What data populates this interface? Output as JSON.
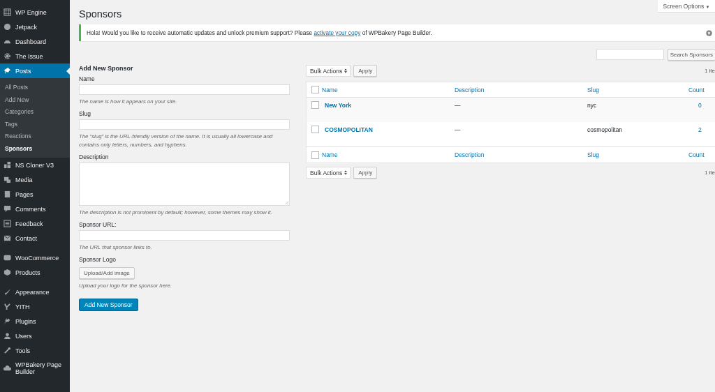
{
  "sidebar": {
    "sections": [
      {
        "items": [
          {
            "label": "WP Engine",
            "selected": false
          },
          {
            "label": "Jetpack",
            "selected": false
          },
          {
            "label": "Dashboard",
            "selected": false
          },
          {
            "label": "The Issue",
            "selected": false
          },
          {
            "label": "Posts",
            "selected": true,
            "children": [
              {
                "label": "All Posts",
                "selected": false
              },
              {
                "label": "Add New",
                "selected": false
              },
              {
                "label": "Categories",
                "selected": false
              },
              {
                "label": "Tags",
                "selected": false
              },
              {
                "label": "Reactions",
                "selected": false
              },
              {
                "label": "Sponsors",
                "selected": true
              }
            ]
          },
          {
            "label": "NS Cloner V3",
            "selected": false
          },
          {
            "label": "Media",
            "selected": false
          },
          {
            "label": "Pages",
            "selected": false
          },
          {
            "label": "Comments",
            "selected": false
          },
          {
            "label": "Feedback",
            "selected": false
          },
          {
            "label": "Contact",
            "selected": false
          }
        ]
      },
      {
        "items": [
          {
            "label": "WooCommerce",
            "selected": false
          },
          {
            "label": "Products",
            "selected": false
          }
        ]
      },
      {
        "items": [
          {
            "label": "Appearance",
            "selected": false
          },
          {
            "label": "YITH",
            "selected": false
          },
          {
            "label": "Plugins",
            "selected": false
          },
          {
            "label": "Users",
            "selected": false
          },
          {
            "label": "Tools",
            "selected": false
          },
          {
            "label": "WPBakery Page Builder",
            "selected": false
          }
        ]
      }
    ]
  },
  "screen_options": {
    "label": "Screen Options",
    "caret": "▼"
  },
  "page_title": "Sponsors",
  "notice": {
    "before": "Hola! Would you like to receive automatic updates and unlock premium support? Please",
    "link": "activate your copy",
    "after": "of WPBakery Page Builder."
  },
  "form": {
    "heading": "Add New Sponsor",
    "fields": [
      {
        "kind": "input",
        "label": "Name",
        "hint": "The name is how it appears on your site."
      },
      {
        "kind": "input",
        "label": "Slug",
        "hint": "The “slug” is the URL-friendly version of the name. It is usually all lowercase and contains only letters, numbers, and hyphens."
      },
      {
        "kind": "textarea",
        "label": "Description",
        "hint": "The description is not prominent by default; however, some themes may show it."
      },
      {
        "kind": "input",
        "label": "Sponsor URL:",
        "hint": "The URL that sponsor links to."
      },
      {
        "kind": "upload",
        "label": "Sponsor Logo",
        "button": "Upload/Add image",
        "hint": "Upload your logo for the sponsor here."
      }
    ],
    "submit": "Add New Sponsor"
  },
  "search": {
    "button": "Search Sponsors"
  },
  "table": {
    "navs": [
      {
        "bulk_action": "Bulk Actions",
        "apply": "Apply",
        "item_count": "1 ite"
      },
      {
        "bulk_action": "Bulk Actions",
        "apply": "Apply",
        "item_count": "1 ite"
      }
    ],
    "columns": [
      "Name",
      "Description",
      "Slug",
      "Count"
    ],
    "footer_columns": [
      "Name",
      "Description",
      "Slug",
      "Count"
    ],
    "select_all_checked": false,
    "rows": [
      {
        "name": "New York",
        "description": "—",
        "slug": "nyc",
        "count": "0",
        "checked": false
      },
      {
        "name": "COSMOPOLITAN",
        "description": "—",
        "slug": "cosmopolitan",
        "count": "2",
        "checked": false
      }
    ]
  }
}
